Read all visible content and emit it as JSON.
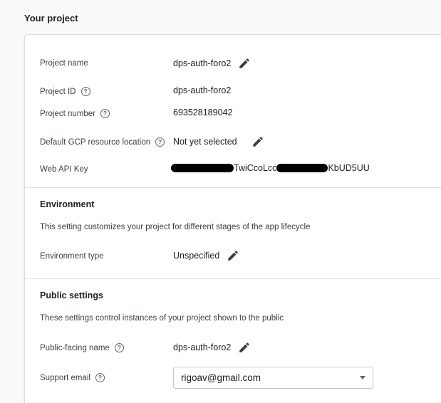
{
  "section": {
    "title": "Your project"
  },
  "project": {
    "name_label": "Project name",
    "name_value": "dps-auth-foro2",
    "id_label": "Project ID",
    "id_value": "dps-auth-foro2",
    "number_label": "Project number",
    "number_value": "693528189042",
    "location_label": "Default GCP resource location",
    "location_value": "Not yet selected",
    "api_key_label": "Web API Key",
    "api_key_part1": "TwiCcoLcc",
    "api_key_part2": "KbUD5UU"
  },
  "environment": {
    "title": "Environment",
    "description": "This setting customizes your project for different stages of the app lifecycle",
    "type_label": "Environment type",
    "type_value": "Unspecified"
  },
  "public_settings": {
    "title": "Public settings",
    "description": "These settings control instances of your project shown to the public",
    "public_name_label": "Public-facing name",
    "public_name_value": "dps-auth-foro2",
    "support_email_label": "Support email",
    "support_email_value": "rigoav@gmail.com"
  },
  "icons": {
    "help": "help-circle-icon",
    "edit": "pencil-icon",
    "dropdown": "dropdown-caret-icon"
  },
  "colors": {
    "text": "#202124",
    "secondary_text": "#3c4043",
    "icon": "#5f6368",
    "divider": "#e0e0e0",
    "background": "#f8f9fa"
  }
}
